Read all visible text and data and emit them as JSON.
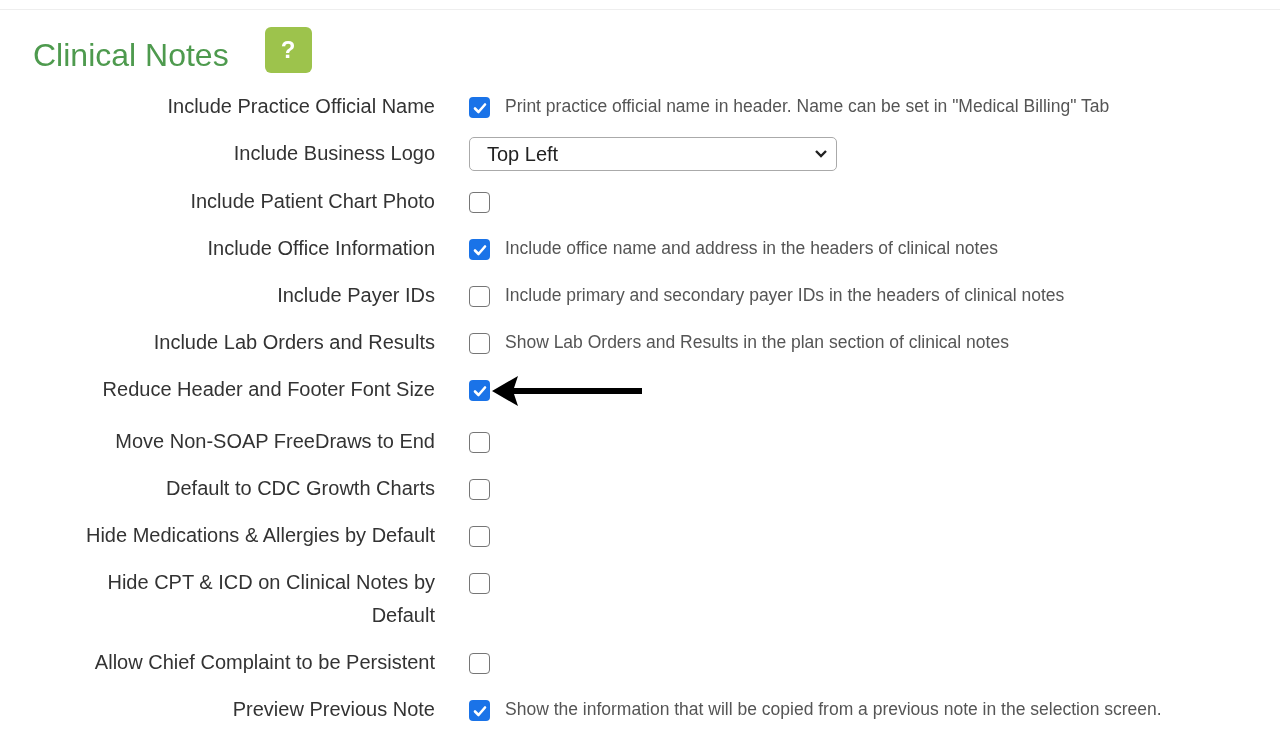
{
  "title": "Clinical Notes",
  "help_button": {
    "label": "?"
  },
  "settings": [
    {
      "label": "Include Practice Official Name",
      "kind": "checkbox",
      "checked": true,
      "description": "Print practice official name in header. Name can be set in \"Medical Billing\" Tab"
    },
    {
      "label": "Include Business Logo",
      "kind": "select",
      "value": "Top Left"
    },
    {
      "label": "Include Patient Chart Photo",
      "kind": "checkbox",
      "checked": false
    },
    {
      "label": "Include Office Information",
      "kind": "checkbox",
      "checked": true,
      "description": "Include office name and address in the headers of clinical notes"
    },
    {
      "label": "Include Payer IDs",
      "kind": "checkbox",
      "checked": false,
      "description": "Include primary and secondary payer IDs in the headers of clinical notes"
    },
    {
      "label": "Include Lab Orders and Results",
      "kind": "checkbox",
      "checked": false,
      "description": "Show Lab Orders and Results in the plan section of clinical notes"
    },
    {
      "label": "Reduce Header and Footer Font Size",
      "kind": "checkbox",
      "checked": true,
      "annotated": true
    },
    {
      "label": "Move Non-SOAP FreeDraws to End",
      "kind": "checkbox",
      "checked": false
    },
    {
      "label": "Default to CDC Growth Charts",
      "kind": "checkbox",
      "checked": false
    },
    {
      "label": "Hide Medications & Allergies by Default",
      "kind": "checkbox",
      "checked": false
    },
    {
      "label": "Hide CPT & ICD on Clinical Notes by Default",
      "kind": "checkbox",
      "checked": false
    },
    {
      "label": "Allow Chief Complaint to be Persistent",
      "kind": "checkbox",
      "checked": false
    },
    {
      "label": "Preview Previous Note",
      "kind": "checkbox",
      "checked": true,
      "description": "Show the information that will be copied from a previous note in the selection screen."
    }
  ]
}
